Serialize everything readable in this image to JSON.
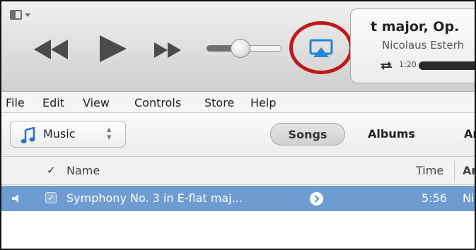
{
  "toolbar": {
    "icons": {
      "sidebar_toggle": "sidebar-toggle-icon",
      "rewind": "rewind-icon",
      "play": "play-icon",
      "fast_forward": "fast-forward-icon",
      "airplay": "airplay-icon"
    },
    "volume_level": 0.4,
    "highlight_color": "#c01818"
  },
  "now_playing": {
    "title": "t major, Op.",
    "artist": "Nicolaus Esterh",
    "elapsed": "1:20",
    "repeat_icon": "repeat-icon"
  },
  "menu": {
    "items": [
      "File",
      "Edit",
      "View",
      "Controls",
      "Store",
      "Help"
    ]
  },
  "library": {
    "source_label": "Music",
    "source_icon": "music-note-icon",
    "views": {
      "songs": "Songs",
      "albums": "Albums",
      "artists": "Ar"
    },
    "selected_view": "Songs"
  },
  "columns": {
    "check": "✓",
    "name": "Name",
    "time": "Time",
    "artist": "Ar"
  },
  "rows": [
    {
      "check": "✓",
      "name": "Symphony No. 3 in E-flat maj...",
      "time": "5:56",
      "artist": "Ni"
    }
  ],
  "colors": {
    "selected_row": "#6f9cd0",
    "airplay_blue": "#1f86d6"
  }
}
